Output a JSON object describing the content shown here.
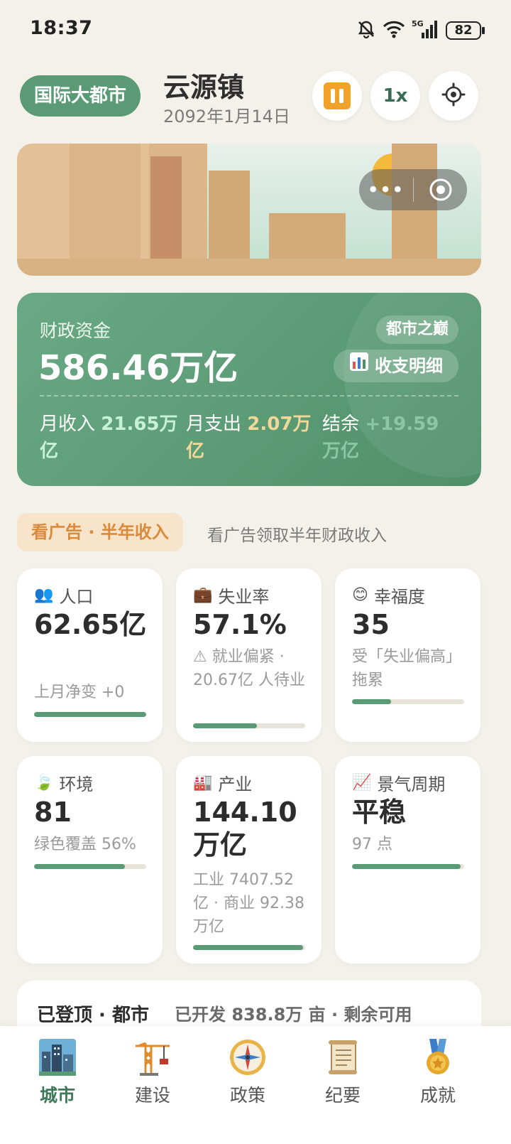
{
  "status_bar": {
    "time": "18:37",
    "battery": "82",
    "network": "5G"
  },
  "header": {
    "tier_badge": "国际大都市",
    "city_name": "云源镇",
    "date": "2092年1月14日",
    "speed_label": "1x"
  },
  "banner": {
    "menu_dots": "•••"
  },
  "finance": {
    "label": "财政资金",
    "amount": "586.46万亿",
    "rank_badge": "都市之巅",
    "detail_button": "收支明细",
    "income_label": "月收入",
    "income_value": "21.65万亿",
    "expense_label": "月支出",
    "expense_value": "2.07万亿",
    "balance_label": "结余",
    "balance_value": "+19.59万亿",
    "colors": {
      "income": "#c7f2d6",
      "expense": "#f3d79a",
      "balance": "#8bc7a2"
    }
  },
  "ad": {
    "button_label": "看广告 · 半年收入",
    "description": "看广告领取半年财政收入"
  },
  "stats": {
    "population": {
      "icon": "👥",
      "label": "人口",
      "value": "62.65亿",
      "note": "上月净变 +0",
      "progress": 1.0
    },
    "unemployment": {
      "icon": "💼",
      "label": "失业率",
      "value": "57.1%",
      "note": "⚠ 就业偏紧 · 20.67亿 人待业",
      "progress": 0.57
    },
    "happiness": {
      "icon": "😊",
      "label": "幸福度",
      "value": "35",
      "note": "受「失业偏高」拖累",
      "progress": 0.35
    },
    "environment": {
      "icon": "🍃",
      "label": "环境",
      "value": "81",
      "note": "绿色覆盖 56%",
      "progress": 0.81
    },
    "industry": {
      "icon": "🏭",
      "label": "产业",
      "value": "144.10万亿",
      "note": "工业 7407.52亿 · 商业 92.38万亿",
      "progress": 0.98
    },
    "economy": {
      "icon": "📈",
      "label": "景气周期",
      "value": "平稳",
      "note": "97 点",
      "progress": 0.97
    }
  },
  "summary": {
    "title": "已登顶 · 都市",
    "description": "已开发 838.8万 亩 · 剩余可用"
  },
  "nav": [
    {
      "label": "城市",
      "icon": "city-icon",
      "active": true
    },
    {
      "label": "建设",
      "icon": "crane-icon",
      "active": false
    },
    {
      "label": "政策",
      "icon": "compass-icon",
      "active": false
    },
    {
      "label": "纪要",
      "icon": "scroll-icon",
      "active": false
    },
    {
      "label": "成就",
      "icon": "medal-icon",
      "active": false
    }
  ]
}
